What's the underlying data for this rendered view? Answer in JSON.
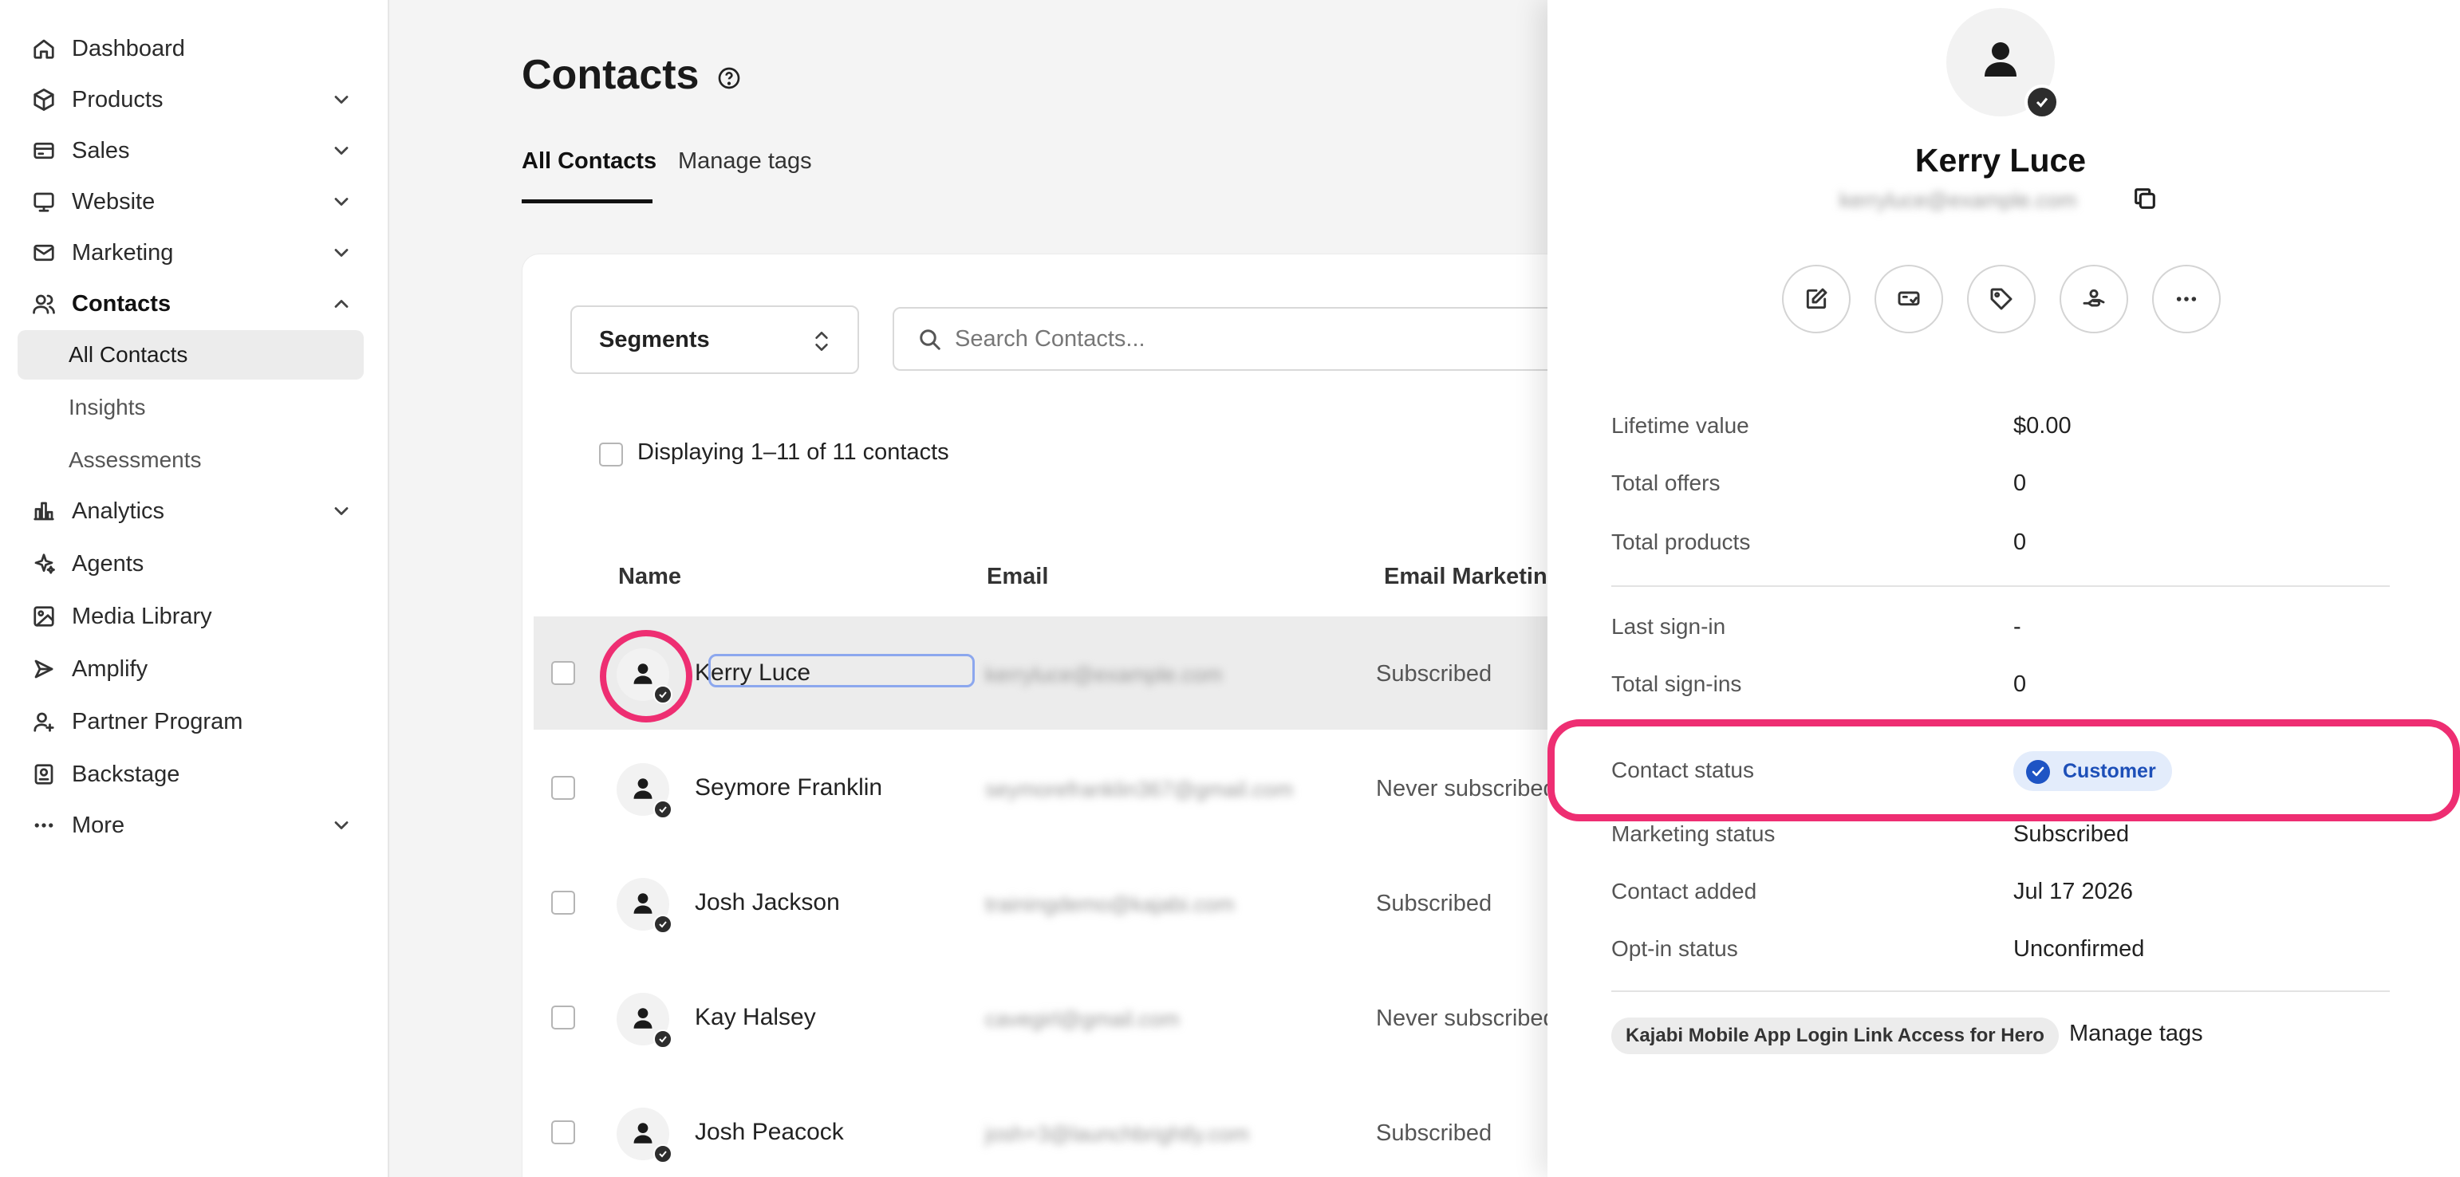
{
  "sidebar": {
    "items": [
      {
        "label": "Dashboard",
        "icon": "home-icon"
      },
      {
        "label": "Products",
        "icon": "box-icon"
      },
      {
        "label": "Sales",
        "icon": "credit-card-icon"
      },
      {
        "label": "Website",
        "icon": "monitor-icon"
      },
      {
        "label": "Marketing",
        "icon": "mail-icon"
      },
      {
        "label": "Contacts",
        "icon": "users-icon"
      },
      {
        "label": "Analytics",
        "icon": "bar-chart-icon"
      },
      {
        "label": "Agents",
        "icon": "sparkle-icon"
      },
      {
        "label": "Media Library",
        "icon": "image-icon"
      },
      {
        "label": "Amplify",
        "icon": "megaphone-icon"
      },
      {
        "label": "Partner Program",
        "icon": "person-plus-icon"
      },
      {
        "label": "Backstage",
        "icon": "badge-icon"
      },
      {
        "label": "More",
        "icon": "ellipsis-icon"
      }
    ],
    "contacts_sub": [
      "All Contacts",
      "Insights",
      "Assessments"
    ]
  },
  "main": {
    "title": "Contacts",
    "tabs": [
      "All Contacts",
      "Manage tags"
    ],
    "segments_label": "Segments",
    "search_placeholder": "Search Contacts...",
    "display_count": "Displaying 1–11 of 11 contacts",
    "columns": [
      "Name",
      "Email",
      "Email Marketing"
    ],
    "rows": [
      {
        "name": "Kerry Luce",
        "email": "kerryluce@example.com",
        "status": "Subscribed"
      },
      {
        "name": "Seymore Franklin",
        "email": "seymorefranklin367@gmail.com",
        "status": "Never subscribed"
      },
      {
        "name": "Josh Jackson",
        "email": "trainingdemo@kajabi.com",
        "status": "Subscribed"
      },
      {
        "name": "Kay Halsey",
        "email": "cavegirl@gmail.com",
        "status": "Never subscribed"
      },
      {
        "name": "Josh Peacock",
        "email": "josh+3@launchbrightly.com",
        "status": "Subscribed"
      }
    ]
  },
  "panel": {
    "name": "Kerry Luce",
    "email": "kerryluce@example.com",
    "info": [
      {
        "label": "Lifetime value",
        "value": "$0.00"
      },
      {
        "label": "Total offers",
        "value": "0"
      },
      {
        "label": "Total products",
        "value": "0"
      },
      {
        "label": "Last sign-in",
        "value": "-"
      },
      {
        "label": "Total sign-ins",
        "value": "0"
      },
      {
        "label": "Contact status",
        "value": "Customer"
      },
      {
        "label": "Marketing status",
        "value": "Subscribed"
      },
      {
        "label": "Contact added",
        "value": "Jul 17 2026"
      },
      {
        "label": "Opt-in status",
        "value": "Unconfirmed"
      }
    ],
    "tag": "Kajabi Mobile App Login Link Access for Hero",
    "manage_tags": "Manage tags"
  },
  "colors": {
    "highlight": "#ee2e72",
    "customer_badge": "#1e54c4"
  }
}
